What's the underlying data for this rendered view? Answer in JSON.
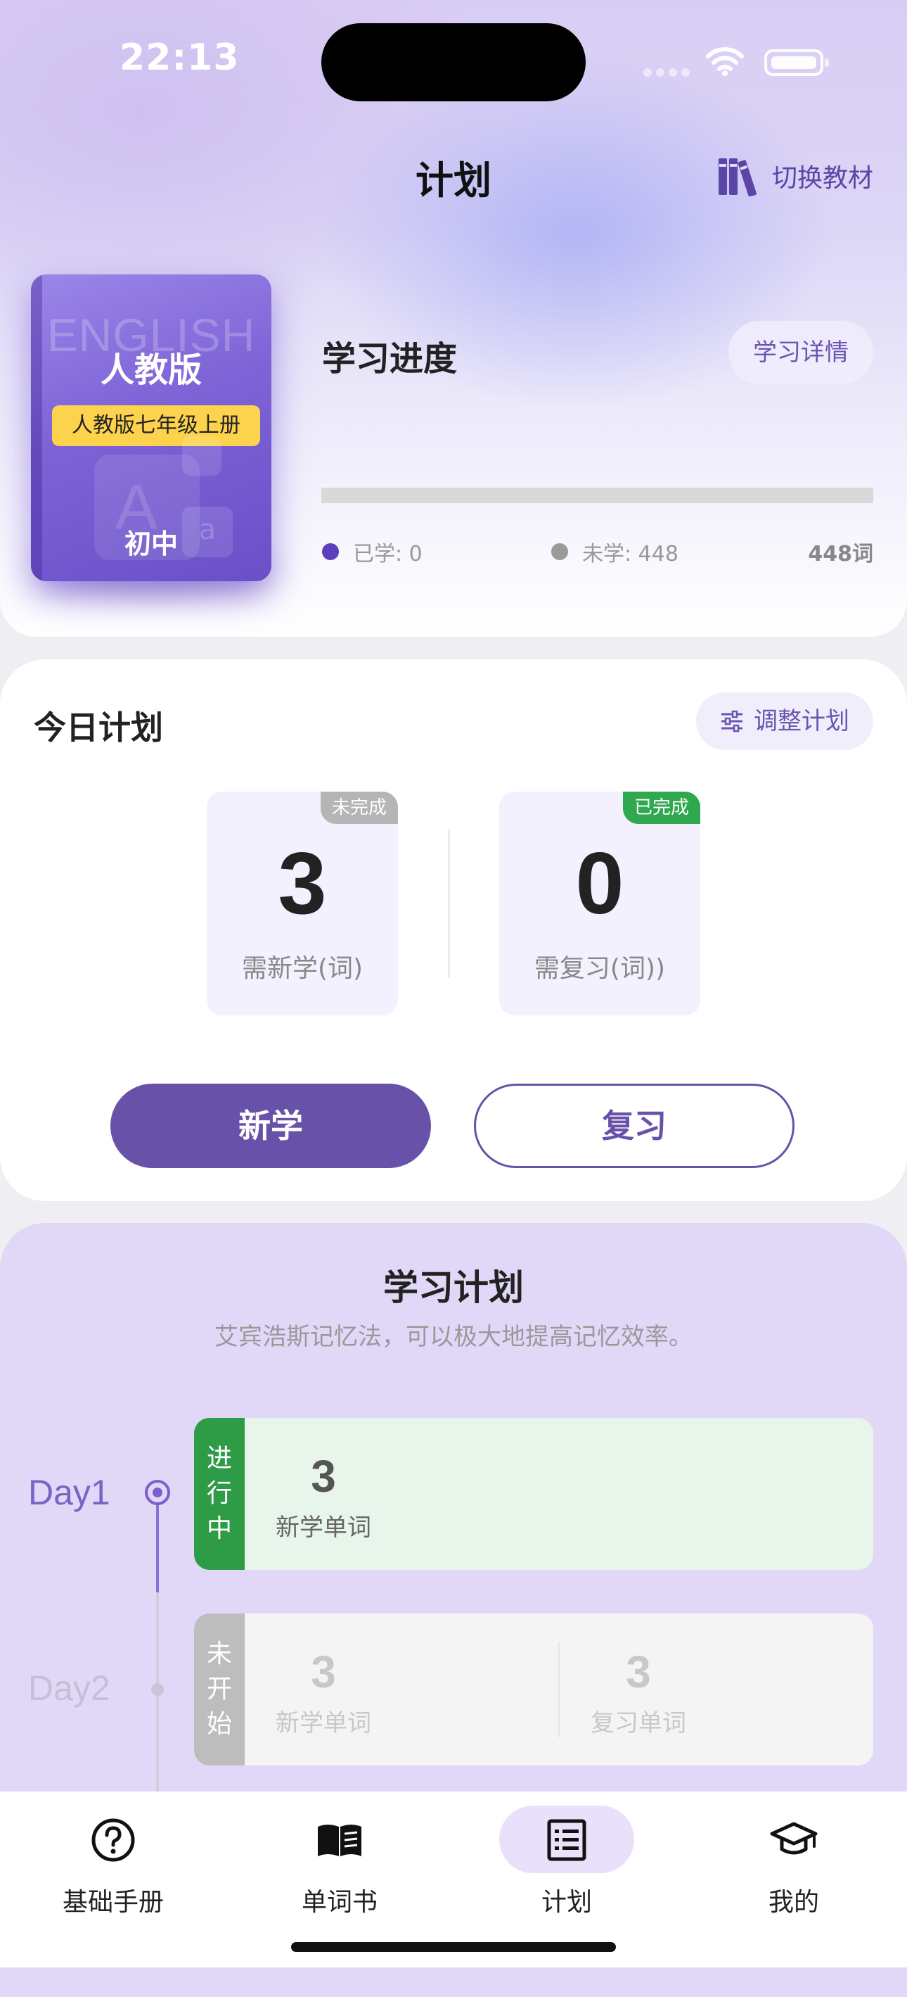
{
  "status_bar": {
    "time": "22:13"
  },
  "header": {
    "title": "计划",
    "switch_label": "切换教材"
  },
  "book": {
    "watermark": "ENGLISH",
    "edition": "人教版",
    "volume": "人教版七年级上册",
    "level": "初中",
    "deco_a": "A",
    "deco_b": "a"
  },
  "progress": {
    "title": "学习进度",
    "detail_button": "学习详情",
    "learned_label": "已学: 0",
    "unlearned_label": "未学: 448",
    "total_label": "448词",
    "learned_fraction": 0,
    "learned_color": "#5b3fbd",
    "unlearned_color": "#9a9a9a"
  },
  "today_plan": {
    "title": "今日计划",
    "adjust_button": "调整计划",
    "new": {
      "badge": "未完成",
      "count": "3",
      "label": "需新学(词)",
      "badge_color": "#b5b5b5"
    },
    "review": {
      "badge": "已完成",
      "count": "0",
      "label": "需复习(词))",
      "badge_color": "#2fa84f"
    },
    "new_button": "新学",
    "review_button": "复习"
  },
  "study_plan": {
    "title": "学习计划",
    "subtitle": "艾宾浩斯记忆法，可以极大地提高记忆效率。",
    "days": [
      {
        "day": "Day1",
        "status": [
          "进",
          "行",
          "中"
        ],
        "new_count": "3",
        "new_label": "新学单词"
      },
      {
        "day": "Day2",
        "status": [
          "未",
          "开",
          "始"
        ],
        "new_count": "3",
        "new_label": "新学单词",
        "review_count": "3",
        "review_label": "复习单词"
      }
    ]
  },
  "tabbar": {
    "items": [
      {
        "label": "基础手册",
        "icon": "question-circle-icon"
      },
      {
        "label": "单词书",
        "icon": "open-book-icon"
      },
      {
        "label": "计划",
        "icon": "list-icon",
        "active": true
      },
      {
        "label": "我的",
        "icon": "graduation-cap-icon"
      }
    ]
  }
}
